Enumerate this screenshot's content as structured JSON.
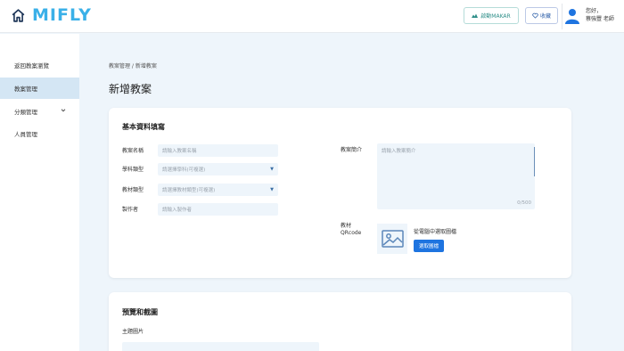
{
  "header": {
    "logo_text": "MIFLY",
    "makar_button": "啟動MAKAR",
    "favorites_button": "收藏",
    "greeting": "您好，",
    "user_name": "蔡強豐 老師"
  },
  "sidebar": {
    "items": [
      {
        "label": "返回教案瀏覽",
        "active": false
      },
      {
        "label": "教案管理",
        "active": true
      },
      {
        "label": "分類管理",
        "active": false,
        "expandable": true
      },
      {
        "label": "人員管理",
        "active": false
      }
    ]
  },
  "breadcrumb": "教案管理 / 新增教案",
  "page_title": "新增教案",
  "basic_info": {
    "title": "基本資料填寫",
    "fields": {
      "name": {
        "label": "教案名稱",
        "placeholder": "請輸入教案名稱"
      },
      "subject": {
        "label": "學科類型",
        "placeholder": "請選擇學科(可複選)"
      },
      "material": {
        "label": "教材類型",
        "placeholder": "請選擇教材類型(可複選)"
      },
      "author": {
        "label": "製作者",
        "placeholder": "請輸入製作者"
      },
      "intro": {
        "label": "教案簡介",
        "placeholder": "請輸入教案簡介",
        "counter": "0/500"
      },
      "qrcode": {
        "label_line1": "教材",
        "label_line2": "QRcode",
        "hint": "從電腦中選取圖檔",
        "button": "選取圖檔"
      }
    }
  },
  "preview": {
    "title": "預覽和截圖",
    "theme_image_label": "主題圖片"
  },
  "colors": {
    "accent": "#1e74e0",
    "logo": "#3ab0e8",
    "page_bg": "#eef5fb",
    "sidebar_active": "#d4e6f4"
  }
}
